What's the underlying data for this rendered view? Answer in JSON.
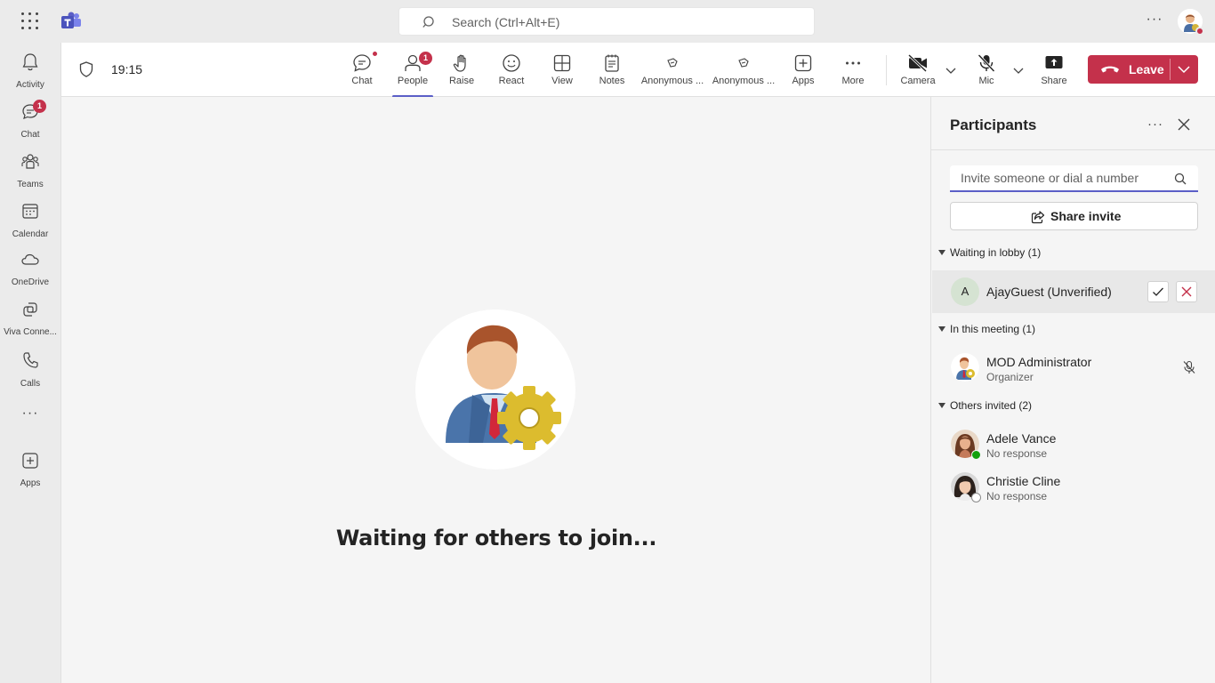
{
  "titlebar": {
    "search_placeholder": "Search (Ctrl+Alt+E)",
    "more_label": "···"
  },
  "rail": {
    "items": [
      {
        "label": "Activity",
        "icon": "bell-icon"
      },
      {
        "label": "Chat",
        "icon": "chat-icon",
        "badge": "1"
      },
      {
        "label": "Teams",
        "icon": "teams-icon"
      },
      {
        "label": "Calendar",
        "icon": "calendar-icon"
      },
      {
        "label": "OneDrive",
        "icon": "cloud-icon"
      },
      {
        "label": "Viva Conne...",
        "icon": "viva-connections-icon"
      },
      {
        "label": "Calls",
        "icon": "phone-icon"
      },
      {
        "label": "Apps",
        "icon": "plus-box-icon"
      }
    ],
    "more_label": "···"
  },
  "meeting": {
    "timer": "19:15",
    "toolbar": {
      "chat": "Chat",
      "people": "People",
      "people_badge": "1",
      "raise": "Raise",
      "react": "React",
      "view": "View",
      "notes": "Notes",
      "anon1": "Anonymous ...",
      "anon2": "Anonymous ...",
      "apps": "Apps",
      "more": "More",
      "camera": "Camera",
      "mic": "Mic",
      "share": "Share",
      "leave": "Leave"
    },
    "accent_color": "#5b5fc7",
    "leave_color": "#c4314b"
  },
  "stage": {
    "waiting_text": "Waiting for others to join..."
  },
  "participants": {
    "title": "Participants",
    "more_label": "···",
    "invite_placeholder": "Invite someone or dial a number",
    "share_invite": "Share invite",
    "lobby_header": "Waiting in lobby (1)",
    "lobby": [
      {
        "initial": "A",
        "name": "AjayGuest (Unverified)"
      }
    ],
    "meeting_header": "In this meeting (1)",
    "in_meeting": [
      {
        "name": "MOD Administrator",
        "role": "Organizer",
        "mic": "muted"
      }
    ],
    "invited_header": "Others invited (2)",
    "invited": [
      {
        "name": "Adele Vance",
        "status": "No response",
        "presence": "available"
      },
      {
        "name": "Christie Cline",
        "status": "No response",
        "presence": "offline"
      }
    ]
  }
}
